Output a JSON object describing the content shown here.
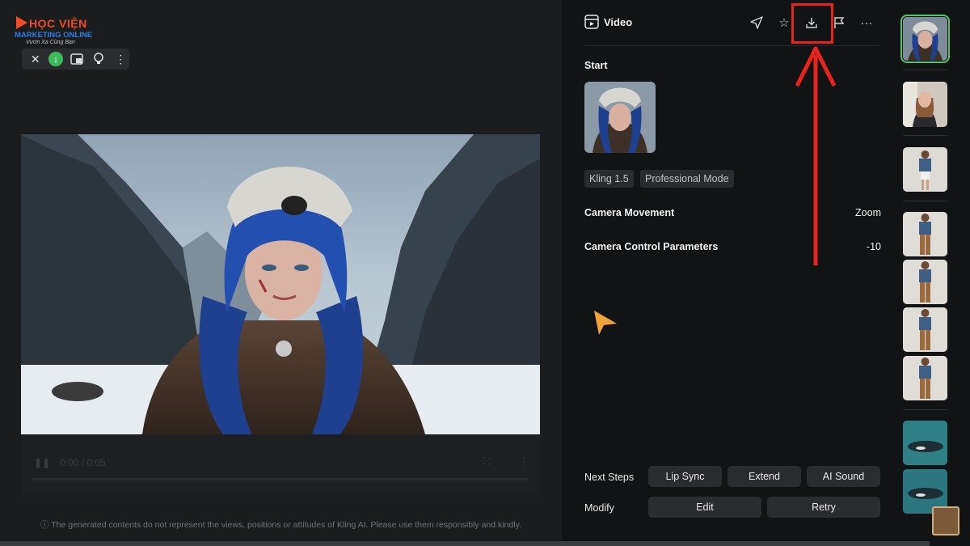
{
  "logo": {
    "line1": "HỌC VIỆN",
    "line2": "MARKETING ONLINE",
    "line3": "Vươn Xa Cùng Bạn"
  },
  "toolbar": {
    "close_icon": "close-icon",
    "download_icon": "download-icon",
    "picture_in_picture_icon": "pip-icon",
    "idea_icon": "lightbulb-icon",
    "more_icon": "more-icon"
  },
  "player": {
    "time": "0:00 / 0:05",
    "disclaimer": "ⓘ The generated contents do not represent the views, positions or attitudes of Kling AI. Please use them responsibly and kindly."
  },
  "panel": {
    "title": "Video",
    "start_label": "Start",
    "tags": [
      "Kling 1.5",
      "Professional Mode"
    ],
    "params": [
      {
        "label": "Camera Movement",
        "value": "Zoom"
      },
      {
        "label": "Camera Control Parameters",
        "value": "-10"
      }
    ],
    "next_steps_label": "Next Steps",
    "next_steps": [
      "Lip Sync",
      "Extend",
      "AI Sound"
    ],
    "modify_label": "Modify",
    "modify": [
      "Edit",
      "Retry"
    ]
  },
  "colors": {
    "accent_highlight": "#e8231b",
    "selection": "#57c26b",
    "cursor": "#f2a23a"
  }
}
